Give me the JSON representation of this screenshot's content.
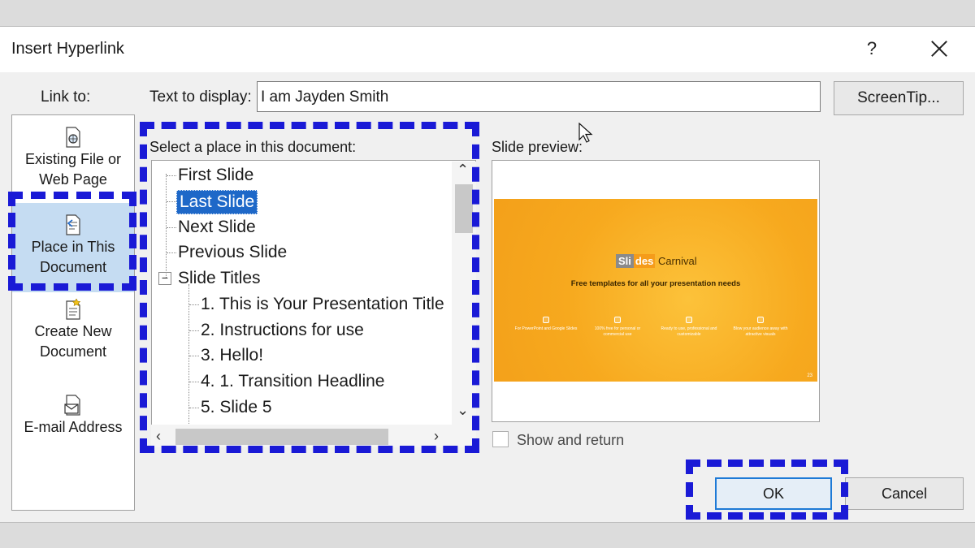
{
  "dialog": {
    "title": "Insert Hyperlink",
    "help_label": "?"
  },
  "link_to": {
    "label": "Link to:",
    "items": [
      {
        "label_line1": "Existing File or",
        "label_line2": "Web Page",
        "icon": "globe-file-icon"
      },
      {
        "label_line1": "Place in This",
        "label_line2": "Document",
        "icon": "document-place-icon",
        "selected": true
      },
      {
        "label_line1": "Create New",
        "label_line2": "Document",
        "icon": "new-document-icon"
      },
      {
        "label_line1": "E-mail Address",
        "label_line2": "",
        "icon": "email-icon"
      }
    ]
  },
  "text_to_display": {
    "label": "Text to display:",
    "value": "I am Jayden Smith"
  },
  "screentip_label": "ScreenTip...",
  "place": {
    "label": "Select a place in this document:",
    "items": [
      {
        "text": "First Slide",
        "level": 0
      },
      {
        "text": "Last Slide",
        "level": 0,
        "selected": true
      },
      {
        "text": "Next Slide",
        "level": 0
      },
      {
        "text": "Previous Slide",
        "level": 0
      },
      {
        "text": "Slide Titles",
        "level": 0,
        "expander": "−"
      },
      {
        "text": "1. This is Your Presentation Title",
        "level": 1
      },
      {
        "text": "2. Instructions for use",
        "level": 1
      },
      {
        "text": "3. Hello!",
        "level": 1
      },
      {
        "text": "4. 1. Transition Headline",
        "level": 1
      },
      {
        "text": "5. Slide 5",
        "level": 1
      }
    ]
  },
  "preview": {
    "label": "Slide preview:",
    "slide": {
      "brand_part1": "Sli",
      "brand_part2": "des",
      "brand_part3": "Carnival",
      "tagline": "Free templates for all your presentation needs",
      "features": [
        "For PowerPoint and Google Slides",
        "100% free for personal or commercial use",
        "Ready to use, professional and customizable",
        "Blow your audience away with attractive visuals"
      ],
      "page_number": "23"
    }
  },
  "show_and_return_label": "Show and return",
  "buttons": {
    "ok": "OK",
    "cancel": "Cancel"
  },
  "colors": {
    "highlight": "#1a1ad6",
    "selection": "#1e68c8",
    "nav_selected": "#c5dcf2",
    "slide_orange": "#f7a91e"
  }
}
